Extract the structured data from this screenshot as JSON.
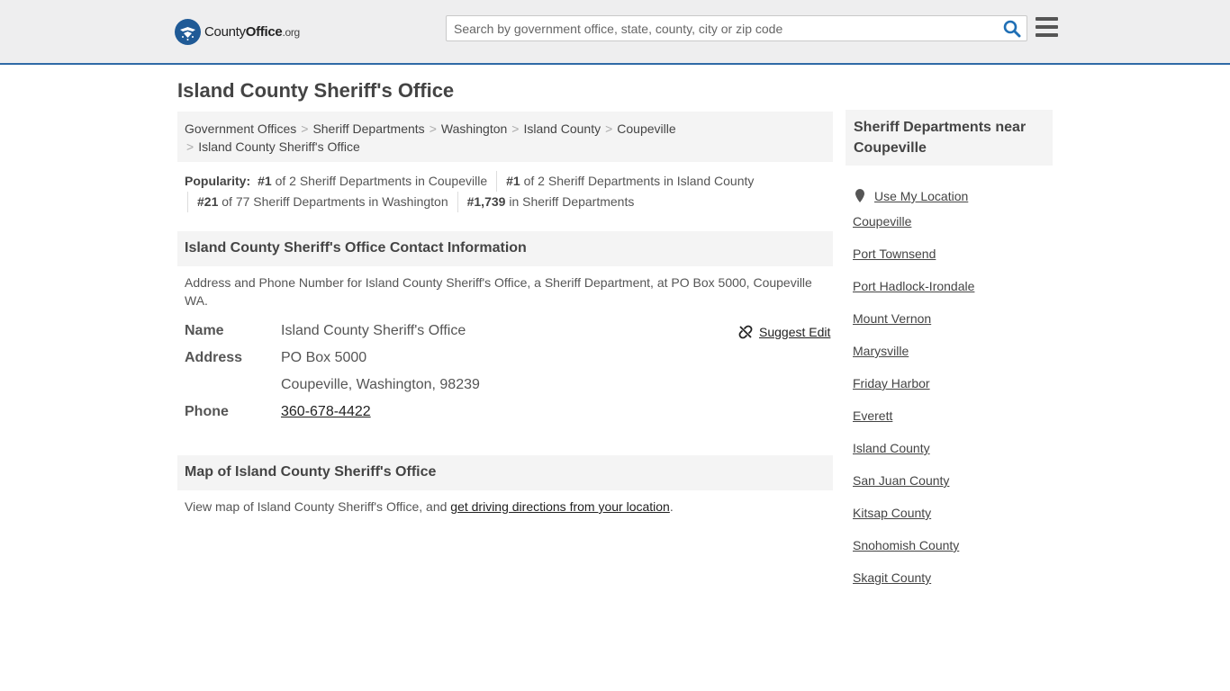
{
  "header": {
    "logo": {
      "name": "County",
      "bold": "Office",
      "suffix": ".org"
    },
    "search_placeholder": "Search by government office, state, county, city or zip code",
    "colors": {
      "accent": "#2f6aa6",
      "seal": "#1f5a96",
      "search_icon": "#1f6fb5"
    }
  },
  "page": {
    "title": "Island County Sheriff's Office"
  },
  "breadcrumb": [
    "Government Offices",
    "Sheriff Departments",
    "Washington",
    "Island County",
    "Coupeville",
    "Island County Sheriff's Office"
  ],
  "popularity": {
    "label": "Popularity:",
    "items": [
      {
        "rank": "#1",
        "text": "of 2 Sheriff Departments in Coupeville"
      },
      {
        "rank": "#1",
        "text": "of 2 Sheriff Departments in Island County"
      },
      {
        "rank": "#21",
        "text": "of 77 Sheriff Departments in Washington"
      },
      {
        "rank": "#1,739",
        "text": "in Sheriff Departments"
      }
    ]
  },
  "contact": {
    "heading": "Island County Sheriff's Office Contact Information",
    "description": "Address and Phone Number for Island County Sheriff's Office, a Sheriff Department, at PO Box 5000, Coupeville WA.",
    "suggest_edit": "Suggest Edit",
    "name_label": "Name",
    "name_value": "Island County Sheriff's Office",
    "address_label": "Address",
    "address_line1": "PO Box 5000",
    "address_line2": "Coupeville, Washington, 98239",
    "phone_label": "Phone",
    "phone_value": "360-678-4422"
  },
  "map": {
    "heading": "Map of Island County Sheriff's Office",
    "text_before": "View map of Island County Sheriff's Office, and ",
    "link_text": "get driving directions from your location",
    "text_after": "."
  },
  "sidebar": {
    "heading": "Sheriff Departments near Coupeville",
    "use_location": "Use My Location",
    "links": [
      "Coupeville",
      "Port Townsend",
      "Port Hadlock-Irondale",
      "Mount Vernon",
      "Marysville",
      "Friday Harbor",
      "Everett",
      "Island County",
      "San Juan County",
      "Kitsap County",
      "Snohomish County",
      "Skagit County"
    ]
  }
}
